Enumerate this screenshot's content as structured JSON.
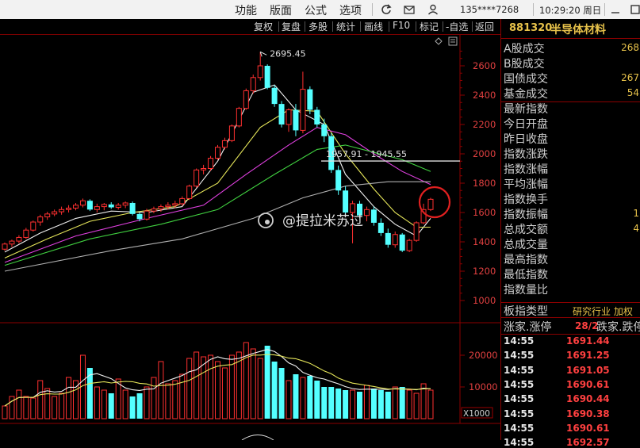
{
  "menu": {
    "function": "功能",
    "layout": "版面",
    "formula": "公式",
    "options": "选项",
    "account": "135****7268",
    "time": "10:29:20 周日"
  },
  "toolbar": [
    "复权",
    "复盘",
    "多股",
    "统计",
    "画线",
    "F10",
    "标记",
    "-自选",
    "返回"
  ],
  "stock": {
    "code": "881320",
    "name": "半导体材料"
  },
  "stats": [
    {
      "label": "A股成交",
      "value": "268"
    },
    {
      "label": "B股成交",
      "value": ""
    },
    {
      "label": "国债成交",
      "value": "267"
    },
    {
      "label": "基金成交",
      "value": "54"
    },
    {
      "label": "最新指数",
      "value": ""
    },
    {
      "label": "今日开盘",
      "value": ""
    },
    {
      "label": "昨日收盘",
      "value": ""
    },
    {
      "label": "指数涨跌",
      "value": ""
    },
    {
      "label": "指数涨幅",
      "value": ""
    },
    {
      "label": "平均涨幅",
      "value": ""
    },
    {
      "label": "指数换手",
      "value": ""
    },
    {
      "label": "指数振幅",
      "value": "1"
    },
    {
      "label": "总成交额",
      "value": "4"
    },
    {
      "label": "总成交量",
      "value": ""
    },
    {
      "label": "最高指数",
      "value": ""
    },
    {
      "label": "最低指数",
      "value": ""
    },
    {
      "label": "指数量比",
      "value": ""
    }
  ],
  "board": {
    "label": "板指类型",
    "value": "研究行业 加权"
  },
  "updown": {
    "label_up": "涨家.涨停",
    "value": "28/2",
    "label_down": "跌家.跌停"
  },
  "ticks": [
    {
      "time": "14:55",
      "price": "1691.44"
    },
    {
      "time": "14:55",
      "price": "1691.25"
    },
    {
      "time": "14:55",
      "price": "1691.05"
    },
    {
      "time": "14:55",
      "price": "1690.61"
    },
    {
      "time": "14:55",
      "price": "1690.44"
    },
    {
      "time": "14:55",
      "price": "1690.38"
    },
    {
      "time": "14:55",
      "price": "1690.61"
    },
    {
      "time": "14:55",
      "price": "1692.57"
    }
  ],
  "watermark": "@提拉米苏过",
  "chart_data": {
    "type": "candlestick",
    "price_axis": {
      "ylim": [
        900,
        2800
      ],
      "ticks": [
        1000,
        1200,
        1400,
        1600,
        1800,
        2000,
        2200,
        2400,
        2600
      ]
    },
    "volume_axis": {
      "ylim": [
        0,
        25000
      ],
      "ticks": [
        10000,
        20000
      ],
      "unit_label": "X1000"
    },
    "annotations": {
      "high_label": "2695.45",
      "high_value": 2695.45,
      "range_label": "1957.91 - 1945.55",
      "level_line": 1951
    },
    "colors": {
      "up": "#ff3030",
      "down": "#54ffff",
      "ma_white": "#f0f0f0",
      "ma_yellow": "#e6e65a",
      "ma_magenta": "#e040e0",
      "ma_green": "#40d040",
      "ma_grey": "#b0b0b0"
    },
    "candles": [
      {
        "o": 1350,
        "h": 1395,
        "l": 1340,
        "c": 1385
      },
      {
        "o": 1385,
        "h": 1415,
        "l": 1365,
        "c": 1405
      },
      {
        "o": 1405,
        "h": 1445,
        "l": 1390,
        "c": 1430
      },
      {
        "o": 1430,
        "h": 1495,
        "l": 1420,
        "c": 1480
      },
      {
        "o": 1480,
        "h": 1545,
        "l": 1470,
        "c": 1535
      },
      {
        "o": 1535,
        "h": 1585,
        "l": 1510,
        "c": 1570
      },
      {
        "o": 1570,
        "h": 1605,
        "l": 1550,
        "c": 1590
      },
      {
        "o": 1590,
        "h": 1620,
        "l": 1575,
        "c": 1605
      },
      {
        "o": 1605,
        "h": 1640,
        "l": 1585,
        "c": 1620
      },
      {
        "o": 1620,
        "h": 1650,
        "l": 1600,
        "c": 1630
      },
      {
        "o": 1630,
        "h": 1665,
        "l": 1615,
        "c": 1650
      },
      {
        "o": 1650,
        "h": 1695,
        "l": 1635,
        "c": 1680
      },
      {
        "o": 1680,
        "h": 1690,
        "l": 1610,
        "c": 1620
      },
      {
        "o": 1620,
        "h": 1660,
        "l": 1600,
        "c": 1640
      },
      {
        "o": 1640,
        "h": 1665,
        "l": 1615,
        "c": 1655
      },
      {
        "o": 1655,
        "h": 1670,
        "l": 1625,
        "c": 1635
      },
      {
        "o": 1635,
        "h": 1665,
        "l": 1620,
        "c": 1650
      },
      {
        "o": 1650,
        "h": 1675,
        "l": 1630,
        "c": 1665
      },
      {
        "o": 1665,
        "h": 1675,
        "l": 1580,
        "c": 1590
      },
      {
        "o": 1590,
        "h": 1600,
        "l": 1540,
        "c": 1555
      },
      {
        "o": 1555,
        "h": 1625,
        "l": 1545,
        "c": 1610
      },
      {
        "o": 1610,
        "h": 1640,
        "l": 1595,
        "c": 1625
      },
      {
        "o": 1625,
        "h": 1655,
        "l": 1605,
        "c": 1640
      },
      {
        "o": 1640,
        "h": 1670,
        "l": 1620,
        "c": 1650
      },
      {
        "o": 1650,
        "h": 1680,
        "l": 1630,
        "c": 1660
      },
      {
        "o": 1660,
        "h": 1710,
        "l": 1645,
        "c": 1695
      },
      {
        "o": 1695,
        "h": 1790,
        "l": 1685,
        "c": 1780
      },
      {
        "o": 1780,
        "h": 1900,
        "l": 1770,
        "c": 1890
      },
      {
        "o": 1890,
        "h": 1925,
        "l": 1860,
        "c": 1900
      },
      {
        "o": 1900,
        "h": 1985,
        "l": 1885,
        "c": 1970
      },
      {
        "o": 1970,
        "h": 2060,
        "l": 1960,
        "c": 2045
      },
      {
        "o": 2045,
        "h": 2110,
        "l": 2030,
        "c": 2090
      },
      {
        "o": 2090,
        "h": 2200,
        "l": 2080,
        "c": 2190
      },
      {
        "o": 2190,
        "h": 2320,
        "l": 2180,
        "c": 2310
      },
      {
        "o": 2310,
        "h": 2445,
        "l": 2300,
        "c": 2430
      },
      {
        "o": 2430,
        "h": 2540,
        "l": 2410,
        "c": 2520
      },
      {
        "o": 2520,
        "h": 2695,
        "l": 2500,
        "c": 2600
      },
      {
        "o": 2600,
        "h": 2610,
        "l": 2440,
        "c": 2450
      },
      {
        "o": 2450,
        "h": 2470,
        "l": 2320,
        "c": 2340
      },
      {
        "o": 2340,
        "h": 2360,
        "l": 2180,
        "c": 2200
      },
      {
        "o": 2200,
        "h": 2310,
        "l": 2150,
        "c": 2300
      },
      {
        "o": 2300,
        "h": 2340,
        "l": 2120,
        "c": 2160
      },
      {
        "o": 2160,
        "h": 2560,
        "l": 2140,
        "c": 2440
      },
      {
        "o": 2440,
        "h": 2460,
        "l": 2270,
        "c": 2300
      },
      {
        "o": 2300,
        "h": 2320,
        "l": 2180,
        "c": 2200
      },
      {
        "o": 2200,
        "h": 2240,
        "l": 2080,
        "c": 2120
      },
      {
        "o": 2120,
        "h": 2140,
        "l": 1870,
        "c": 1890
      },
      {
        "o": 1890,
        "h": 1920,
        "l": 1720,
        "c": 1750
      },
      {
        "o": 1750,
        "h": 1780,
        "l": 1570,
        "c": 1600
      },
      {
        "o": 1600,
        "h": 1680,
        "l": 1390,
        "c": 1660
      },
      {
        "o": 1660,
        "h": 1680,
        "l": 1560,
        "c": 1580
      },
      {
        "o": 1580,
        "h": 1640,
        "l": 1540,
        "c": 1620
      },
      {
        "o": 1620,
        "h": 1640,
        "l": 1510,
        "c": 1530
      },
      {
        "o": 1530,
        "h": 1560,
        "l": 1440,
        "c": 1460
      },
      {
        "o": 1460,
        "h": 1490,
        "l": 1360,
        "c": 1380
      },
      {
        "o": 1380,
        "h": 1470,
        "l": 1360,
        "c": 1450
      },
      {
        "o": 1450,
        "h": 1460,
        "l": 1330,
        "c": 1340
      },
      {
        "o": 1340,
        "h": 1420,
        "l": 1330,
        "c": 1410
      },
      {
        "o": 1410,
        "h": 1540,
        "l": 1400,
        "c": 1530
      },
      {
        "o": 1530,
        "h": 1660,
        "l": 1520,
        "c": 1620
      },
      {
        "o": 1620,
        "h": 1700,
        "l": 1610,
        "c": 1690
      }
    ],
    "volumes": [
      4000,
      7000,
      9000,
      7000,
      6500,
      12000,
      9500,
      7000,
      8000,
      13000,
      12000,
      20000,
      16000,
      10000,
      9000,
      8000,
      12500,
      9000,
      7000,
      8000,
      10000,
      13000,
      18000,
      11000,
      12000,
      14000,
      19000,
      21000,
      19500,
      20000,
      18000,
      16000,
      20000,
      21000,
      24000,
      22000,
      19000,
      23000,
      18000,
      16000,
      12000,
      14000,
      13000,
      13500,
      12000,
      10000,
      10000,
      9500,
      9000,
      9000,
      8500,
      10500,
      9500,
      9000,
      8500,
      10000,
      10000,
      9000,
      8000,
      11000,
      9000
    ],
    "moving_averages": [
      {
        "color": "white",
        "values": [
          [
            0,
            1330
          ],
          [
            5,
            1460
          ],
          [
            10,
            1560
          ],
          [
            15,
            1610
          ],
          [
            20,
            1600
          ],
          [
            25,
            1640
          ],
          [
            30,
            1950
          ],
          [
            35,
            2420
          ],
          [
            38,
            2470
          ],
          [
            41,
            2300
          ],
          [
            45,
            2200
          ],
          [
            48,
            1860
          ],
          [
            52,
            1640
          ],
          [
            55,
            1520
          ],
          [
            58,
            1440
          ],
          [
            60,
            1560
          ]
        ]
      },
      {
        "color": "yellow",
        "values": [
          [
            0,
            1290
          ],
          [
            6,
            1420
          ],
          [
            12,
            1540
          ],
          [
            18,
            1600
          ],
          [
            24,
            1640
          ],
          [
            30,
            1800
          ],
          [
            36,
            2180
          ],
          [
            40,
            2300
          ],
          [
            44,
            2290
          ],
          [
            48,
            2000
          ],
          [
            52,
            1760
          ],
          [
            55,
            1600
          ],
          [
            58,
            1500
          ],
          [
            60,
            1500
          ]
        ]
      },
      {
        "color": "magenta",
        "values": [
          [
            0,
            1260
          ],
          [
            10,
            1440
          ],
          [
            20,
            1560
          ],
          [
            28,
            1650
          ],
          [
            34,
            1860
          ],
          [
            40,
            2060
          ],
          [
            44,
            2180
          ],
          [
            48,
            2130
          ],
          [
            52,
            2000
          ],
          [
            56,
            1880
          ],
          [
            60,
            1790
          ]
        ]
      },
      {
        "color": "green",
        "values": [
          [
            0,
            1240
          ],
          [
            12,
            1420
          ],
          [
            22,
            1520
          ],
          [
            30,
            1620
          ],
          [
            38,
            1860
          ],
          [
            44,
            2030
          ],
          [
            48,
            2060
          ],
          [
            52,
            2010
          ],
          [
            56,
            1960
          ],
          [
            60,
            1880
          ]
        ]
      },
      {
        "color": "grey",
        "values": [
          [
            0,
            1200
          ],
          [
            15,
            1340
          ],
          [
            25,
            1420
          ],
          [
            35,
            1560
          ],
          [
            42,
            1700
          ],
          [
            48,
            1780
          ],
          [
            54,
            1810
          ],
          [
            60,
            1810
          ]
        ]
      }
    ]
  }
}
